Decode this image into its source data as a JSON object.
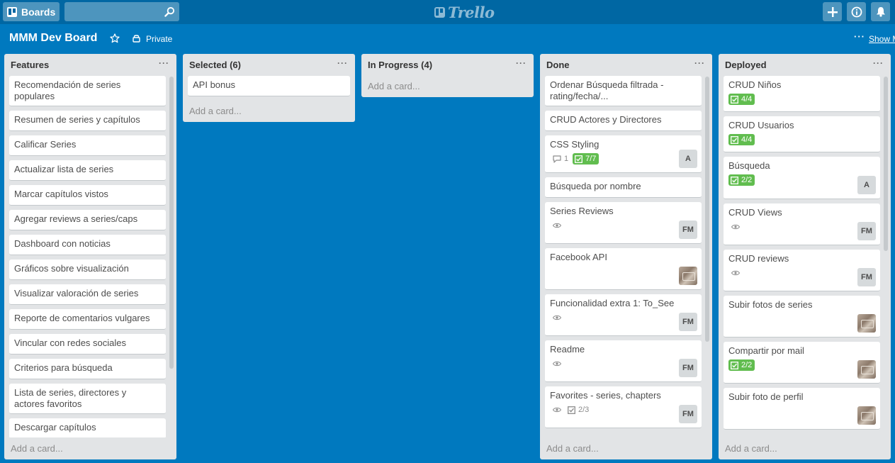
{
  "header": {
    "boards_label": "Boards",
    "search_placeholder": "",
    "logo_text": "Trello"
  },
  "board": {
    "title": "MMM Dev Board",
    "privacy": "Private",
    "show_menu": "Show Menu"
  },
  "lists": [
    {
      "title": "Features",
      "add_card": "Add a card...",
      "cards": [
        {
          "title": "Recomendación de series populares"
        },
        {
          "title": "Resumen de series y capítulos"
        },
        {
          "title": "Calificar Series"
        },
        {
          "title": "Actualizar lista de series"
        },
        {
          "title": "Marcar capítulos vistos"
        },
        {
          "title": "Agregar reviews a series/caps"
        },
        {
          "title": "Dashboard con noticias"
        },
        {
          "title": "Gráficos sobre visualización"
        },
        {
          "title": "Visualizar valoración de series"
        },
        {
          "title": "Reporte de comentarios vulgares"
        },
        {
          "title": "Vincular con redes sociales"
        },
        {
          "title": "Criterios para búsqueda"
        },
        {
          "title": "Lista de series, directores y actores favoritos"
        },
        {
          "title": "Descargar capítulos"
        }
      ]
    },
    {
      "title": "Selected (6)",
      "add_card": "Add a card...",
      "cards": [
        {
          "title": "API bonus"
        }
      ]
    },
    {
      "title": "In Progress (4)",
      "add_card": "Add a card...",
      "cards": []
    },
    {
      "title": "Done",
      "add_card": "Add a card...",
      "cards": [
        {
          "title": "Ordenar Búsqueda filtrada - rating/fecha/..."
        },
        {
          "title": "CRUD Actores y Directores"
        },
        {
          "title": "CSS Styling",
          "comments": "1",
          "checklist": "7/7",
          "checklist_done": true,
          "avatar": "A"
        },
        {
          "title": "Búsqueda por nombre"
        },
        {
          "title": "Series Reviews",
          "watch": true,
          "avatar": "FM"
        },
        {
          "title": "Facebook API",
          "photo": true
        },
        {
          "title": "Funcionalidad extra 1: To_See",
          "watch": true,
          "avatar": "FM"
        },
        {
          "title": "Readme",
          "watch": true,
          "avatar": "FM"
        },
        {
          "title": "Favorites - series, chapters",
          "watch": true,
          "checklist": "2/3",
          "checklist_done": false,
          "avatar": "FM"
        }
      ]
    },
    {
      "title": "Deployed",
      "add_card": "Add a card...",
      "cards": [
        {
          "title": "CRUD Niños",
          "checklist": "4/4",
          "checklist_done": true
        },
        {
          "title": "CRUD Usuarios",
          "checklist": "4/4",
          "checklist_done": true
        },
        {
          "title": "Búsqueda",
          "checklist": "2/2",
          "checklist_done": true,
          "avatar": "A"
        },
        {
          "title": "CRUD Views",
          "watch": true,
          "avatar": "FM"
        },
        {
          "title": "CRUD reviews",
          "watch": true,
          "avatar": "FM"
        },
        {
          "title": "Subir fotos de series",
          "photo": true
        },
        {
          "title": "Compartir por mail",
          "checklist": "2/2",
          "checklist_done": true,
          "photo": true
        },
        {
          "title": "Subir foto de perfil",
          "photo": true
        }
      ]
    }
  ]
}
